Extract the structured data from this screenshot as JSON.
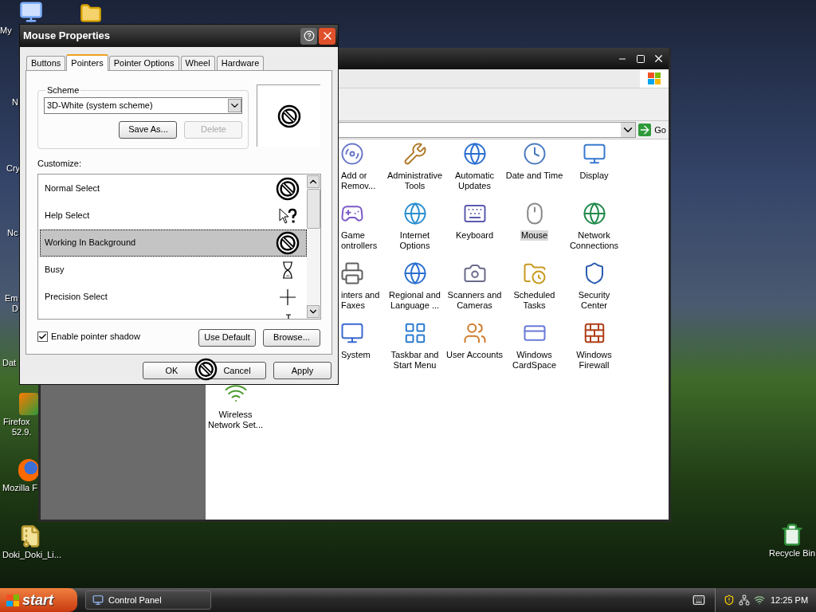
{
  "desktop_icons": [
    {
      "lines": [
        "My"
      ]
    },
    {
      "lines": [
        "N"
      ]
    },
    {
      "lines": [
        "Cry"
      ]
    },
    {
      "lines": [
        "Nc"
      ]
    },
    {
      "lines": [
        "Em",
        "D"
      ]
    },
    {
      "lines": [
        "Dat"
      ]
    },
    {
      "lines": [
        "Firefox",
        "52.9."
      ]
    },
    {
      "lines": [
        "Mozilla F"
      ]
    },
    {
      "lines": [
        "Doki_Doki_Li..."
      ]
    },
    {
      "lines": [
        "Recycle Bin"
      ]
    }
  ],
  "control_panel": {
    "address_go": "Go",
    "items": [
      {
        "lines": [
          "Add or",
          "Remov..."
        ],
        "selected": false
      },
      {
        "lines": [
          "Administrative",
          "Tools"
        ],
        "selected": false
      },
      {
        "lines": [
          "Automatic",
          "Updates"
        ],
        "selected": false
      },
      {
        "lines": [
          "Date and Time"
        ],
        "selected": false
      },
      {
        "lines": [
          "Display"
        ],
        "selected": false
      },
      {
        "lines": [
          "Game",
          "ontrollers"
        ],
        "selected": false
      },
      {
        "lines": [
          "Internet",
          "Options"
        ],
        "selected": false
      },
      {
        "lines": [
          "Keyboard"
        ],
        "selected": false
      },
      {
        "lines": [
          "Mouse"
        ],
        "selected": true
      },
      {
        "lines": [
          "Network",
          "Connections"
        ],
        "selected": false
      },
      {
        "lines": [
          "inters and",
          "Faxes"
        ],
        "selected": false
      },
      {
        "lines": [
          "Regional and",
          "Language ..."
        ],
        "selected": false
      },
      {
        "lines": [
          "Scanners and",
          "Cameras"
        ],
        "selected": false
      },
      {
        "lines": [
          "Scheduled",
          "Tasks"
        ],
        "selected": false
      },
      {
        "lines": [
          "Security",
          "Center"
        ],
        "selected": false
      },
      {
        "lines": [
          "System"
        ],
        "selected": false
      },
      {
        "lines": [
          "Taskbar and",
          "Start Menu"
        ],
        "selected": false
      },
      {
        "lines": [
          "User Accounts"
        ],
        "selected": false
      },
      {
        "lines": [
          "Windows",
          "CardSpace"
        ],
        "selected": false
      },
      {
        "lines": [
          "Windows",
          "Firewall"
        ],
        "selected": false
      },
      {
        "lines": [
          "Wireless",
          "Network Set..."
        ],
        "selected": false
      }
    ]
  },
  "dialog": {
    "title": "Mouse Properties",
    "tabs": [
      {
        "label": "Buttons",
        "selected": false
      },
      {
        "label": "Pointers",
        "selected": true
      },
      {
        "label": "Pointer Options",
        "selected": false
      },
      {
        "label": "Wheel",
        "selected": false
      },
      {
        "label": "Hardware",
        "selected": false
      }
    ],
    "scheme": {
      "legend": "Scheme",
      "value": "3D-White (system scheme)",
      "buttons": [
        {
          "label": "Save As...",
          "disabled": false
        },
        {
          "label": "Delete",
          "disabled": true
        }
      ]
    },
    "customize_label": "Customize:",
    "pointers": [
      {
        "kind": "unavailable",
        "name": "Normal Select",
        "selected": false
      },
      {
        "kind": "help",
        "name": "Help Select",
        "selected": false
      },
      {
        "kind": "unavailable",
        "name": "Working In Background",
        "selected": true
      },
      {
        "kind": "busy",
        "name": "Busy",
        "selected": false
      },
      {
        "kind": "cross",
        "name": "Precision Select",
        "selected": false
      },
      {
        "kind": "text",
        "selected": false
      }
    ],
    "shadow": {
      "label": "Enable pointer shadow",
      "checked": true
    },
    "list_buttons": [
      "Use Default",
      "Browse..."
    ],
    "footer_buttons": [
      "OK",
      "Cancel",
      "Apply"
    ]
  },
  "taskbar": {
    "start": "start",
    "tasks": [
      {
        "label": "Control Panel"
      }
    ],
    "clock": "12:25 PM"
  }
}
